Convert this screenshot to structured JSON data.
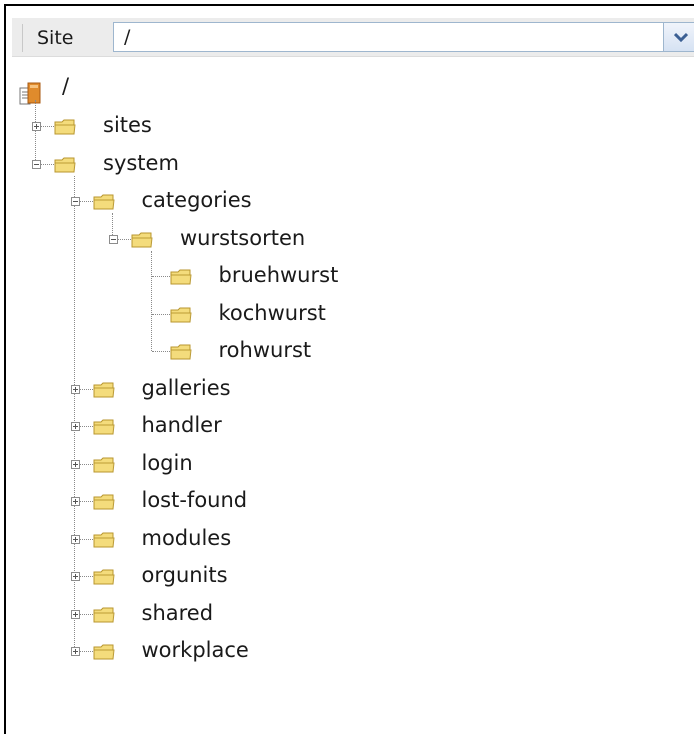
{
  "toolbar": {
    "site_label": "Site",
    "site_value": "/",
    "dropdown_icon": "chevron-down-icon"
  },
  "tree": {
    "root_label": "/",
    "nodes": [
      {
        "label": "sites",
        "depth": 1,
        "expander": "plus"
      },
      {
        "label": "system",
        "depth": 1,
        "expander": "minus"
      },
      {
        "label": "categories",
        "depth": 2,
        "expander": "minus"
      },
      {
        "label": "wurstsorten",
        "depth": 3,
        "expander": "minus"
      },
      {
        "label": "bruehwurst",
        "depth": 4,
        "expander": "none"
      },
      {
        "label": "kochwurst",
        "depth": 4,
        "expander": "none"
      },
      {
        "label": "rohwurst",
        "depth": 4,
        "expander": "none"
      },
      {
        "label": "galleries",
        "depth": 2,
        "expander": "plus"
      },
      {
        "label": "handler",
        "depth": 2,
        "expander": "plus"
      },
      {
        "label": "login",
        "depth": 2,
        "expander": "plus"
      },
      {
        "label": "lost-found",
        "depth": 2,
        "expander": "plus"
      },
      {
        "label": "modules",
        "depth": 2,
        "expander": "plus"
      },
      {
        "label": "orgunits",
        "depth": 2,
        "expander": "plus"
      },
      {
        "label": "shared",
        "depth": 2,
        "expander": "plus"
      },
      {
        "label": "workplace",
        "depth": 2,
        "expander": "plus"
      }
    ]
  },
  "colors": {
    "folder_fill": "#f4dc7c",
    "folder_stroke": "#b8962e",
    "root_icon": "#e08b2c"
  }
}
